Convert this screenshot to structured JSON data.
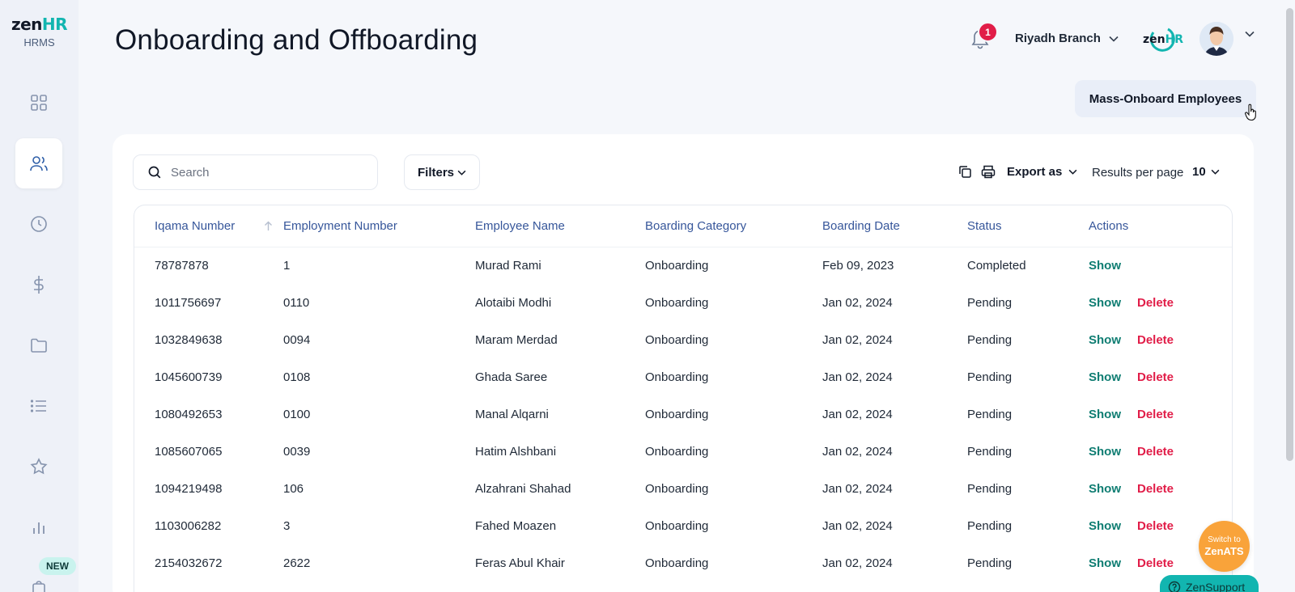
{
  "app": {
    "logo_zen": "zen",
    "logo_hr": "HR",
    "logo_sub": "HRMS",
    "zen_mark_zen": "zen",
    "zen_mark_hr": "HR"
  },
  "sidebar": {
    "items": [
      {
        "icon": "dashboard-icon",
        "active": false
      },
      {
        "icon": "users-icon",
        "active": true
      },
      {
        "icon": "clock-icon",
        "active": false
      },
      {
        "icon": "dollar-icon",
        "active": false
      },
      {
        "icon": "folder-icon",
        "active": false
      },
      {
        "icon": "list-icon",
        "active": false
      },
      {
        "icon": "star-icon",
        "active": false
      },
      {
        "icon": "chart-icon",
        "active": false
      },
      {
        "icon": "bag-icon",
        "active": false
      }
    ],
    "new_badge": "NEW"
  },
  "header": {
    "title": "Onboarding and Offboarding",
    "notification_count": "1",
    "branch": "Riyadh Branch"
  },
  "actions": {
    "mass_onboard": "Mass-Onboard Employees"
  },
  "toolbar": {
    "search_placeholder": "Search",
    "filters": "Filters",
    "export": "Export as",
    "results_per_page_label": "Results per page",
    "results_per_page_value": "10"
  },
  "table": {
    "columns": [
      "Iqama Number",
      "Employment Number",
      "Employee Name",
      "Boarding Category",
      "Boarding Date",
      "Status",
      "Actions"
    ],
    "show_label": "Show",
    "delete_label": "Delete",
    "rows": [
      {
        "iqama": "78787878",
        "employment": "1",
        "name": "Murad Rami",
        "category": "Onboarding",
        "date": "Feb 09, 2023",
        "status": "Completed",
        "can_delete": false
      },
      {
        "iqama": "1011756697",
        "employment": "0110",
        "name": "Alotaibi Modhi",
        "category": "Onboarding",
        "date": "Jan 02, 2024",
        "status": "Pending",
        "can_delete": true
      },
      {
        "iqama": "1032849638",
        "employment": "0094",
        "name": "Maram Merdad",
        "category": "Onboarding",
        "date": "Jan 02, 2024",
        "status": "Pending",
        "can_delete": true
      },
      {
        "iqama": "1045600739",
        "employment": "0108",
        "name": "Ghada Saree",
        "category": "Onboarding",
        "date": "Jan 02, 2024",
        "status": "Pending",
        "can_delete": true
      },
      {
        "iqama": "1080492653",
        "employment": "0100",
        "name": "Manal Alqarni",
        "category": "Onboarding",
        "date": "Jan 02, 2024",
        "status": "Pending",
        "can_delete": true
      },
      {
        "iqama": "1085607065",
        "employment": "0039",
        "name": "Hatim Alshbani",
        "category": "Onboarding",
        "date": "Jan 02, 2024",
        "status": "Pending",
        "can_delete": true
      },
      {
        "iqama": "1094219498",
        "employment": "106",
        "name": "Alzahrani Shahad",
        "category": "Onboarding",
        "date": "Jan 02, 2024",
        "status": "Pending",
        "can_delete": true
      },
      {
        "iqama": "1103006282",
        "employment": "3",
        "name": "Fahed Moazen",
        "category": "Onboarding",
        "date": "Jan 02, 2024",
        "status": "Pending",
        "can_delete": true
      },
      {
        "iqama": "2154032672",
        "employment": "2622",
        "name": "Feras Abul Khair",
        "category": "Onboarding",
        "date": "Jan 02, 2024",
        "status": "Pending",
        "can_delete": true
      }
    ]
  },
  "floating": {
    "zenats_small": "Switch to",
    "zenats_big": "ZenATS",
    "zensupport": "ZenSupport"
  },
  "colors": {
    "accent_teal": "#12b5b0",
    "show_green": "#0f7d72",
    "delete_red": "#e11d48",
    "header_blue": "#36569a",
    "zenats_orange": "#f9a33a"
  }
}
